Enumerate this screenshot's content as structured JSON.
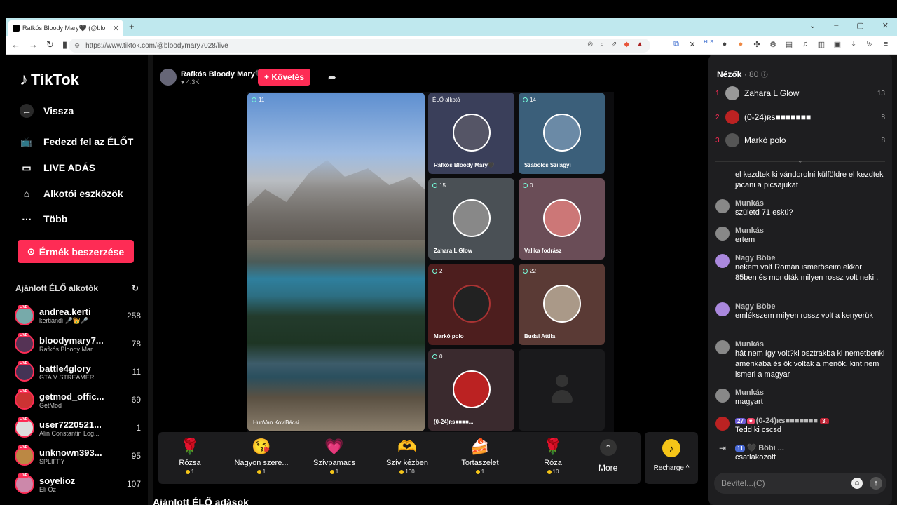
{
  "browser": {
    "tab_title": "Rafkós Bloody Mary🖤 (@blo",
    "url": "https://www.tiktok.com/@bloodymary7028/live"
  },
  "sidebar": {
    "logo": "TikTok",
    "back": "Vissza",
    "nav": [
      {
        "label": "Fedezd fel az ÉLŐT",
        "icon": "tv-icon"
      },
      {
        "label": "LIVE ADÁS",
        "icon": "video-camera-icon"
      },
      {
        "label": "Alkotói eszközök",
        "icon": "creator-tools-icon"
      },
      {
        "label": "Több",
        "icon": "more-dots-icon"
      }
    ],
    "coins_button": "Érmék beszerzése",
    "recommended_title": "Ajánlott ÉLŐ alkotók",
    "creators": [
      {
        "name": "andrea.kerti",
        "sub": "kertiandi 🎤👑🎤",
        "count": "258"
      },
      {
        "name": "bloodymary7...",
        "sub": "Rafkós Bloody Mar...",
        "count": "78"
      },
      {
        "name": "battle4glory",
        "sub": "GTA V STREAMER",
        "count": "11"
      },
      {
        "name": "getmod_offic...",
        "sub": "GetMod",
        "count": "69"
      },
      {
        "name": "user7220521...",
        "sub": "Alin Constantin Log...",
        "count": "1"
      },
      {
        "name": "unknown393...",
        "sub": "SPLIFFY",
        "count": "95"
      },
      {
        "name": "soyelioz",
        "sub": "Eli Oz",
        "count": "107"
      }
    ]
  },
  "main": {
    "host_name": "Rafkós Bloody Mary🖤",
    "host_likes": "♥ 4.3K",
    "follow": "+ Követés",
    "big_tile_name": "HunVan KoviBácsi",
    "big_tile_count": "11",
    "tiles": [
      {
        "name": "Rafkós Bloody Mary🖤",
        "count": "ÉLŐ alkotó",
        "color": "#3a3f5a"
      },
      {
        "name": "Szabolcs Szilágyi",
        "count": "14",
        "color": "#3b5f7a"
      },
      {
        "name": "Zahara L Glow",
        "count": "15",
        "color": "#4a5055"
      },
      {
        "name": "Valika fodrász",
        "count": "0",
        "color": "#6a4d57"
      },
      {
        "name": "Markó polo",
        "count": "2",
        "color": "#4d1e1e"
      },
      {
        "name": "Budai Attila",
        "count": "22",
        "color": "#5a3a35"
      },
      {
        "name": "(0-24)ʀs■■■■...",
        "count": "0",
        "color": "#3a2a2e"
      }
    ],
    "gifts": [
      {
        "name": "Rózsa",
        "price": "1",
        "icon": "🌹"
      },
      {
        "name": "Nagyon szere...",
        "price": "1",
        "icon": "😘"
      },
      {
        "name": "Szívpamacs",
        "price": "1",
        "icon": "💗"
      },
      {
        "name": "Szív kézben",
        "price": "100",
        "icon": "🫶"
      },
      {
        "name": "Tortaszelet",
        "price": "1",
        "icon": "🍰"
      },
      {
        "name": "Róza",
        "price": "10",
        "icon": "🌹"
      }
    ],
    "more": "More",
    "recharge": "Recharge ^",
    "recommended_live": "Ajánlott ÉLŐ adások"
  },
  "panel": {
    "title": "Nézők",
    "count": "· 80",
    "viewers": [
      {
        "rank": "1",
        "name": "Zahara L Glow",
        "score": "13"
      },
      {
        "rank": "2",
        "name": "(0-24)ʀs■■■■■■■",
        "score": "8"
      },
      {
        "rank": "3",
        "name": "Markó polo",
        "score": "8"
      }
    ],
    "messages": [
      {
        "user": "",
        "text": "el kezdtek ki vándorolni külföldre el kezdtek jacani a picsajukat"
      },
      {
        "user": "Munkás",
        "text": "születd 71 eskü?"
      },
      {
        "user": "Munkás",
        "text": "ertem"
      },
      {
        "user": "Nagy Böbe",
        "text": "nekem volt Román ismerőseim ekkor 85ben és mondták milyen rossz volt neki ."
      },
      {
        "user": "Nagy Böbe",
        "text": "emlékszem milyen rossz volt a kenyerük"
      },
      {
        "user": "Munkás",
        "text": "hát nem így volt?ki osztrakba ki nemetbenki amerikába és ők voltak a menők. kint nem ismeri a magyar"
      },
      {
        "user": "Munkás",
        "text": "magyart"
      },
      {
        "user": "(0-24)ʀs■■■■■■■",
        "text": "Tedd ki cscsd",
        "badge": "27",
        "badge2": "3."
      },
      {
        "user": "🖤 Böbi ...",
        "text": "csatlakozott",
        "badge": "11"
      }
    ],
    "input_placeholder": "Bevitel...(C)"
  }
}
